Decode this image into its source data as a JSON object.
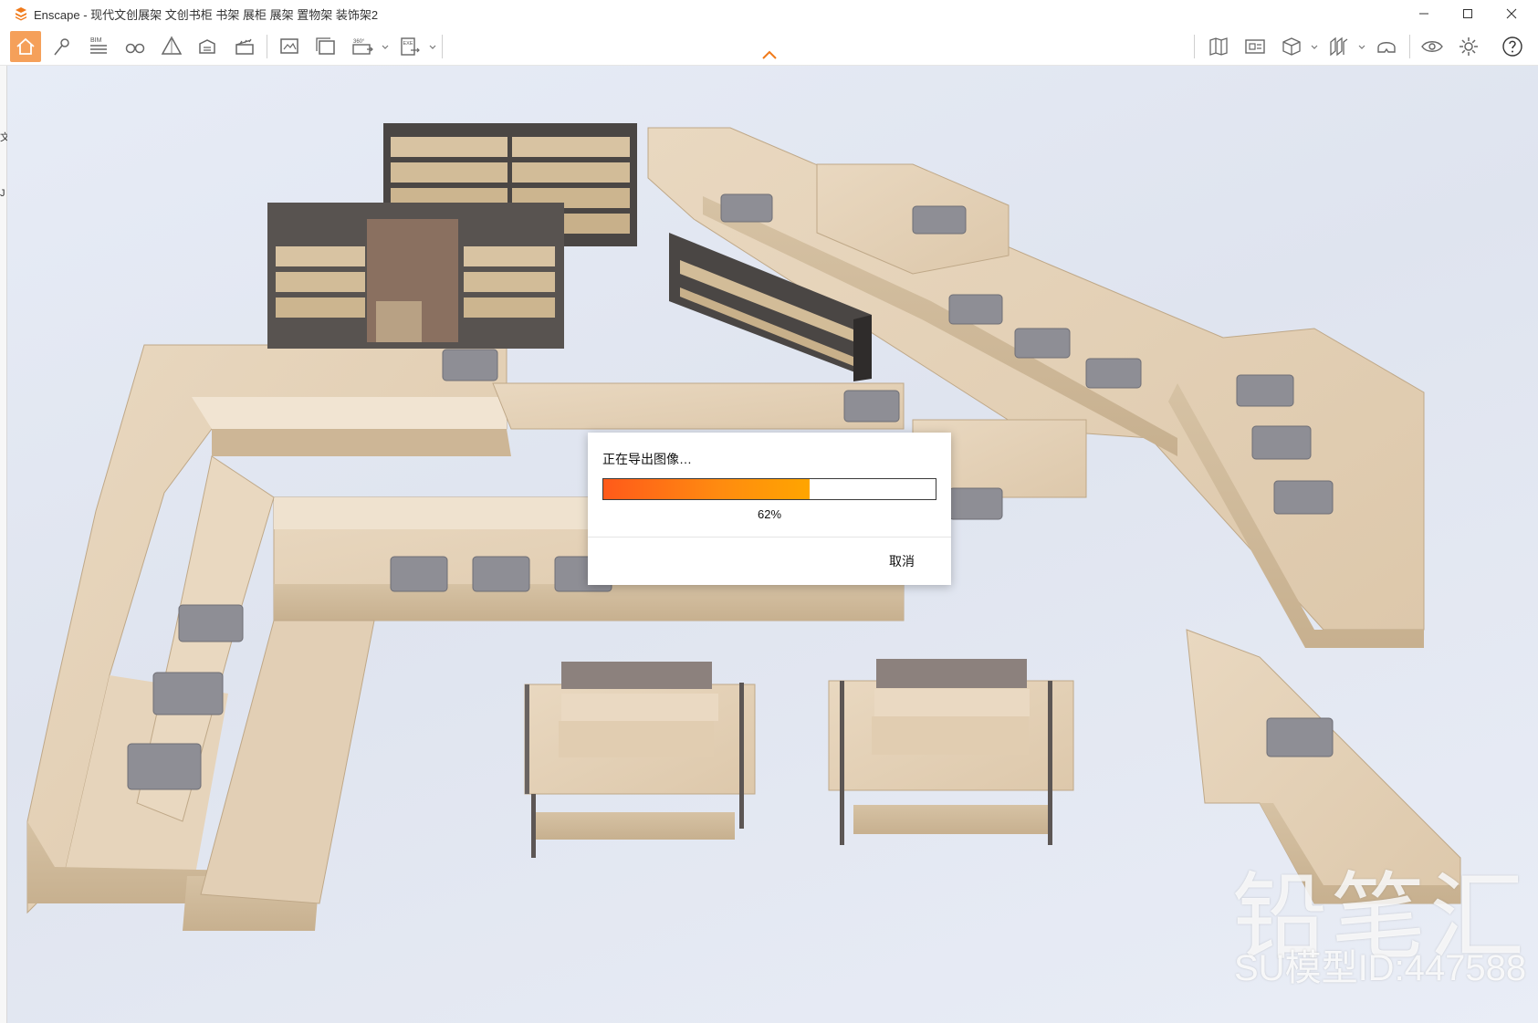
{
  "window": {
    "title": "Enscape - 现代文创展架 文创书柜 书架 展柜 展架 置物架 装饰架2",
    "controls": [
      "minimize",
      "maximize",
      "close"
    ]
  },
  "toolbar": {
    "left_tools": [
      {
        "icon": "home-icon"
      },
      {
        "icon": "location-pin-icon"
      },
      {
        "icon": "bim-icon",
        "label": "BIM"
      },
      {
        "icon": "binoculars-icon"
      },
      {
        "icon": "prism-icon"
      },
      {
        "icon": "asset-library-icon"
      },
      {
        "icon": "clapper-icon"
      },
      {
        "icon": "screenshot-icon"
      },
      {
        "icon": "batch-render-icon"
      },
      {
        "icon": "panorama-icon",
        "label": "360°"
      },
      {
        "icon": "export-exe-icon",
        "label": "EXE"
      }
    ],
    "right_tools": [
      {
        "icon": "map-icon"
      },
      {
        "icon": "view-management-icon"
      },
      {
        "icon": "cube-icon"
      },
      {
        "icon": "sections-icon"
      },
      {
        "icon": "helmet-icon"
      },
      {
        "icon": "eye-icon"
      },
      {
        "icon": "settings-gear-icon"
      },
      {
        "icon": "help-icon"
      }
    ],
    "accent": "#f5a05a"
  },
  "left_strip": {
    "chars": [
      "文",
      "J"
    ]
  },
  "dialog": {
    "title": "正在导出图像…",
    "progress": 0.62,
    "percent_label": "62%",
    "cancel_label": "取消",
    "progress_colors": [
      "#ff5a1a",
      "#ffa500"
    ]
  },
  "watermark": {
    "brand": "铅笔汇",
    "model_id": "SU模型ID:447588"
  }
}
